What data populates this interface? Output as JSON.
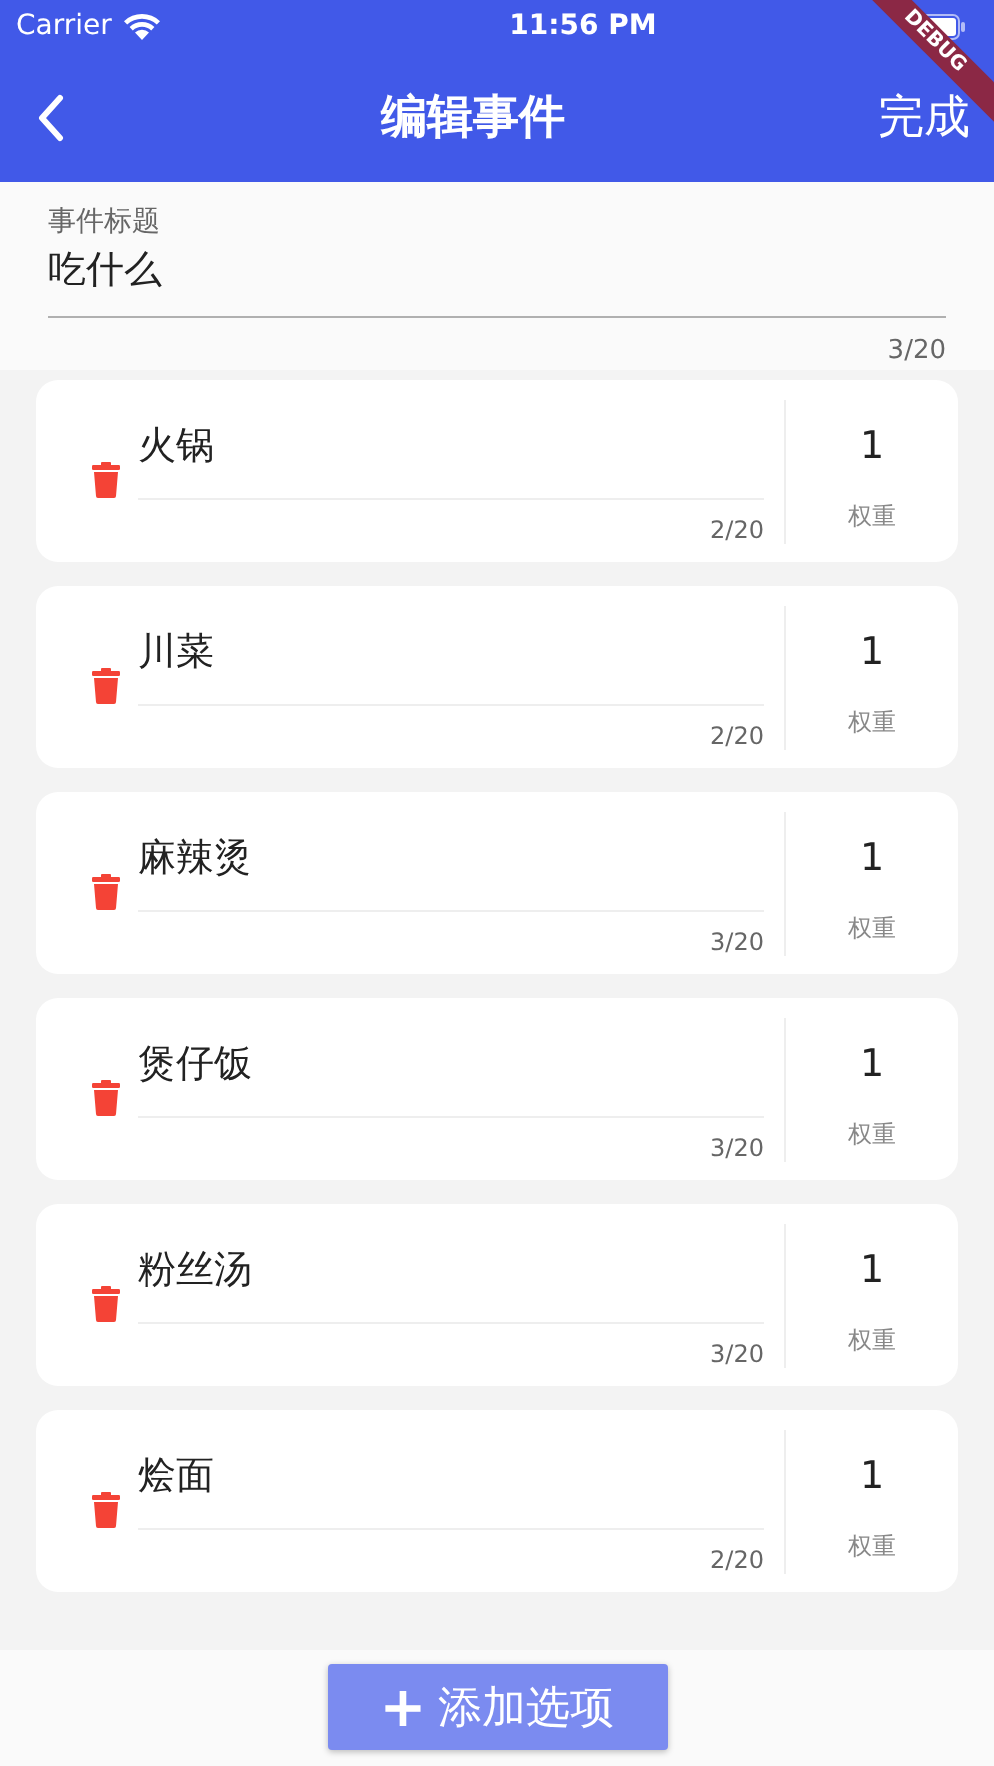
{
  "status_bar": {
    "carrier": "Carrier",
    "time": "11:56 PM"
  },
  "debug_banner": "DEBUG",
  "app_bar": {
    "title": "编辑事件",
    "action": "完成"
  },
  "title_field": {
    "label": "事件标题",
    "value": "吃什么",
    "counter": "3/20"
  },
  "options": [
    {
      "name": "火锅",
      "counter": "2/20",
      "weight": "1",
      "weight_label": "权重"
    },
    {
      "name": "川菜",
      "counter": "2/20",
      "weight": "1",
      "weight_label": "权重"
    },
    {
      "name": "麻辣烫",
      "counter": "3/20",
      "weight": "1",
      "weight_label": "权重"
    },
    {
      "name": "煲仔饭",
      "counter": "3/20",
      "weight": "1",
      "weight_label": "权重"
    },
    {
      "name": "粉丝汤",
      "counter": "3/20",
      "weight": "1",
      "weight_label": "权重"
    },
    {
      "name": "烩面",
      "counter": "2/20",
      "weight": "1",
      "weight_label": "权重"
    }
  ],
  "add_button": {
    "icon": "+",
    "label": "添加选项"
  }
}
